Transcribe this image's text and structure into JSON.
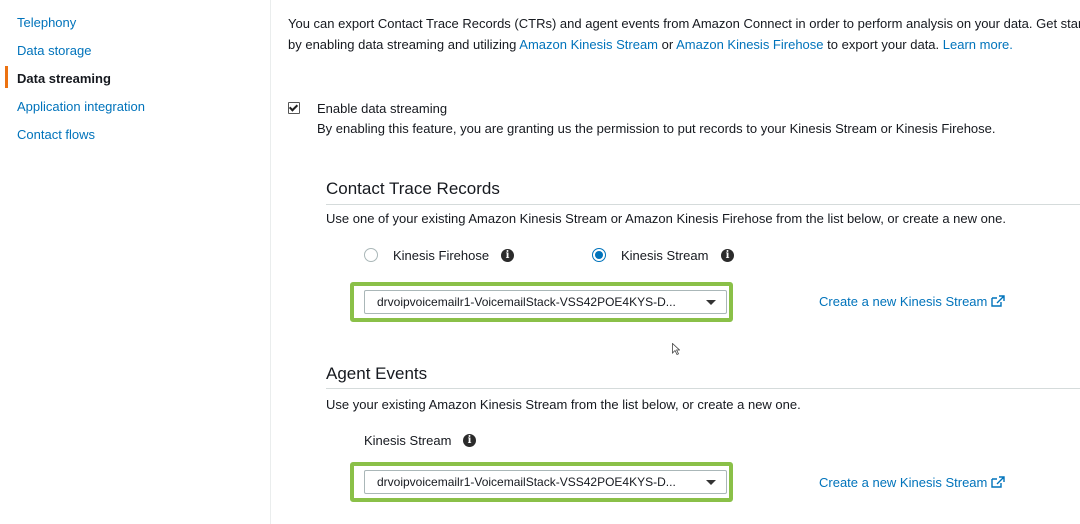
{
  "sidebar": {
    "items": [
      {
        "label": "Telephony"
      },
      {
        "label": "Data storage"
      },
      {
        "label": "Data streaming",
        "active": true
      },
      {
        "label": "Application integration"
      },
      {
        "label": "Contact flows"
      }
    ]
  },
  "intro": {
    "line1": "You can export Contact Trace Records (CTRs) and agent events from Amazon Connect in order to perform analysis on your data. Get started",
    "line2_prefix": "by enabling data streaming and utilizing",
    "link_kinesis_stream": "Amazon Kinesis Stream",
    "or": "or",
    "link_kinesis_firehose": "Amazon Kinesis Firehose",
    "line2_suffix": "to export your data.",
    "learn_more": "Learn more."
  },
  "enable": {
    "checked": true,
    "label": "Enable data streaming",
    "description": "By enabling this feature, you are granting us the permission to put records to your Kinesis Stream or Kinesis Firehose."
  },
  "ctr": {
    "title": "Contact Trace Records",
    "description": "Use one of your existing Amazon Kinesis Stream or Amazon Kinesis Firehose from the list below, or create a new one.",
    "option_firehose": "Kinesis Firehose",
    "option_stream": "Kinesis Stream",
    "selected_option": "Kinesis Stream",
    "select_value": "drvoipvoicemailr1-VoicemailStack-VSS42POE4KYS-D...",
    "create_link": "Create a new Kinesis Stream"
  },
  "agent": {
    "title": "Agent Events",
    "description": "Use your existing Amazon Kinesis Stream from the list below, or create a new one.",
    "stream_label": "Kinesis Stream",
    "select_value": "drvoipvoicemailr1-VoicemailStack-VSS42POE4KYS-D...",
    "create_link": "Create a new Kinesis Stream"
  },
  "colors": {
    "link": "#0073bb",
    "highlight": "#8ac048",
    "active_bar": "#ec7211"
  },
  "icons": {
    "info": "info-icon",
    "external": "external-link-icon",
    "caret": "caret-down-icon"
  }
}
